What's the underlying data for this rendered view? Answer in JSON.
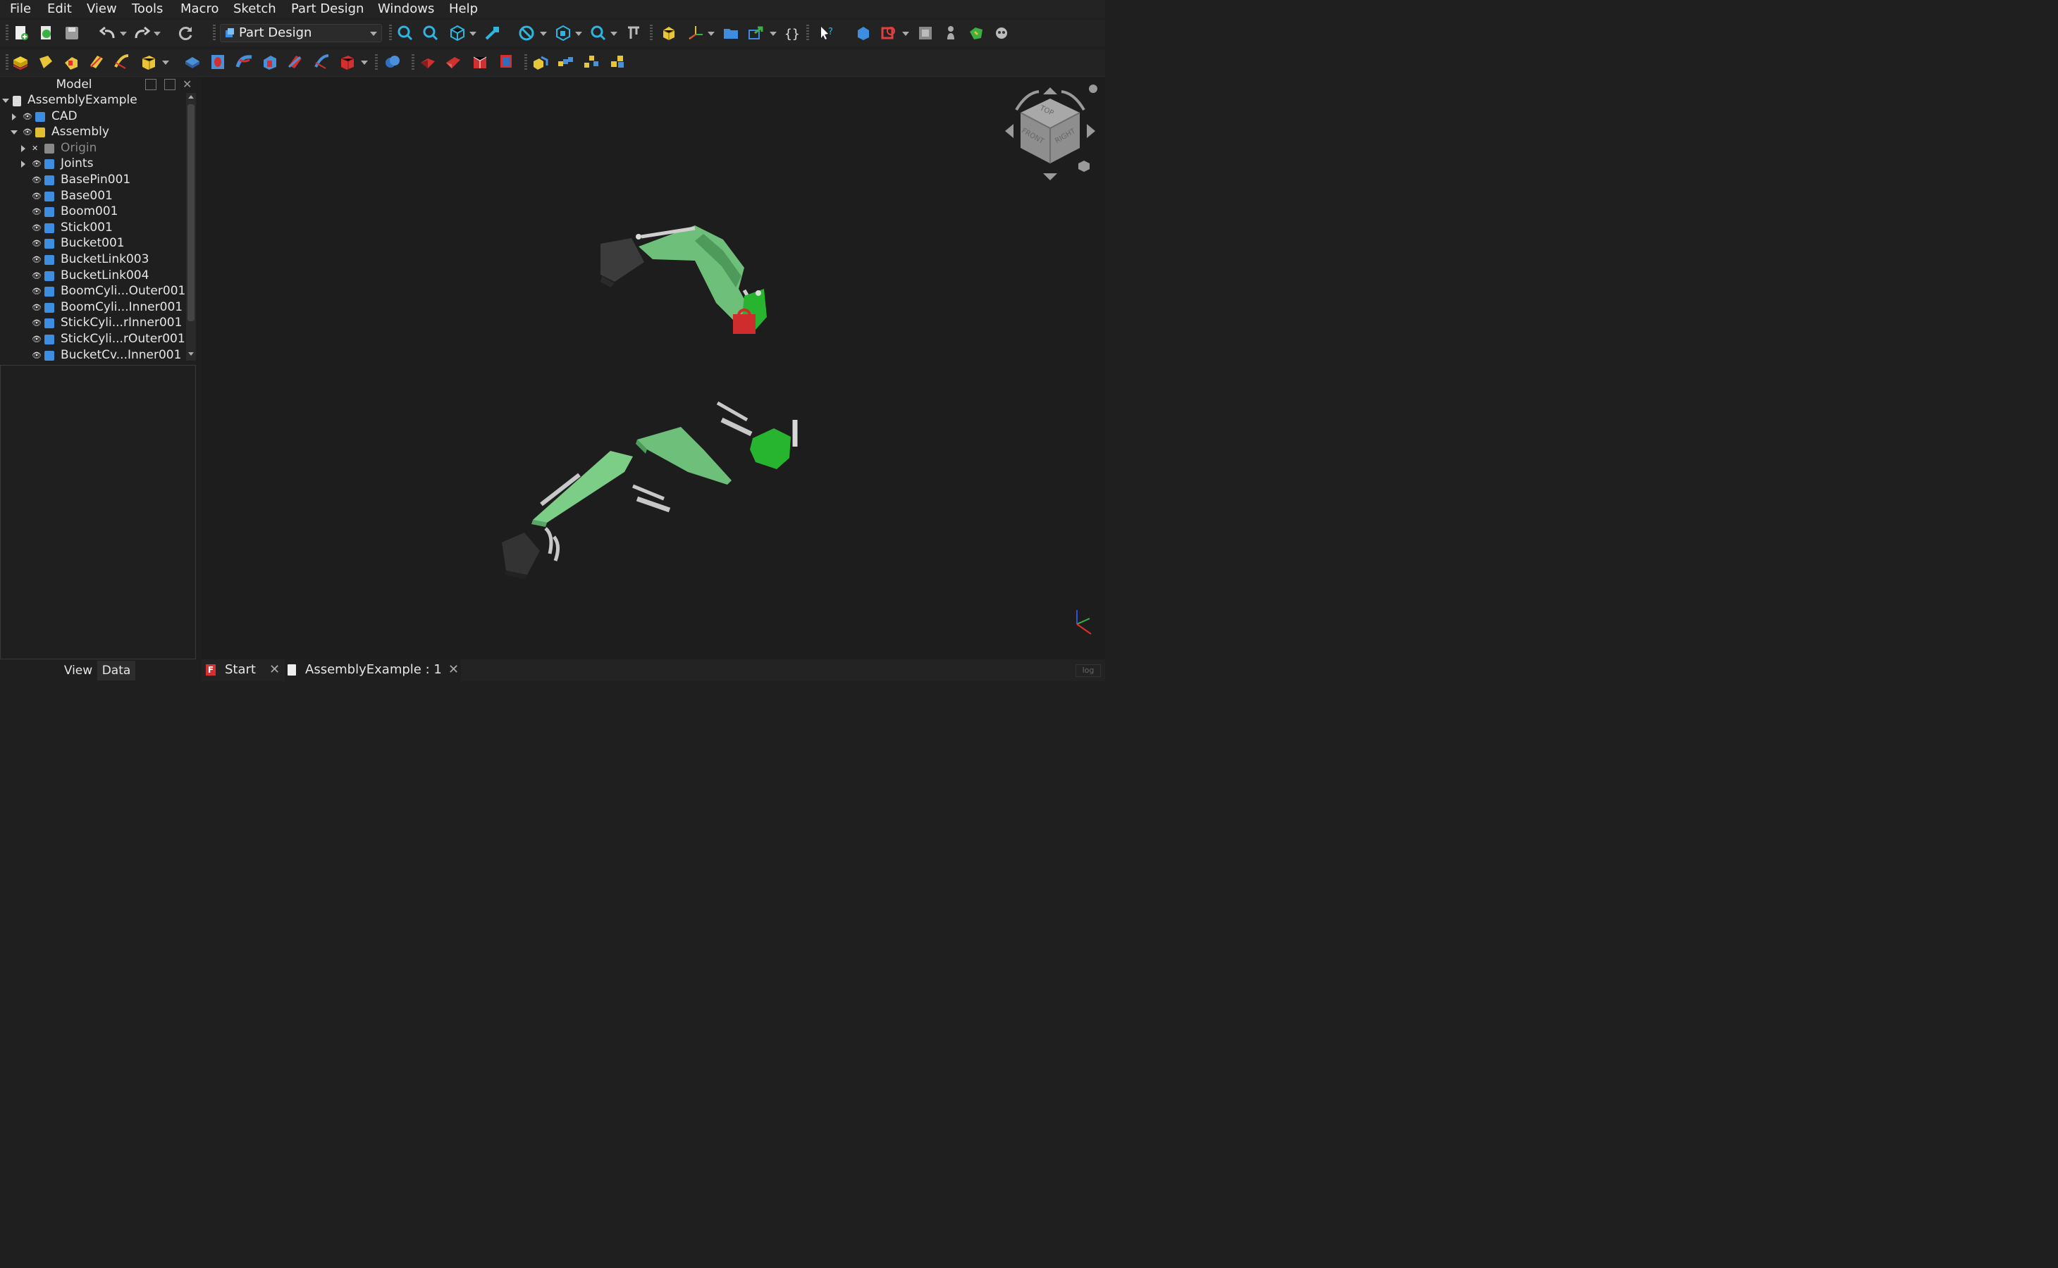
{
  "menu": [
    "File",
    "Edit",
    "View",
    "Tools",
    "Macro",
    "Sketch",
    "Part Design",
    "Windows",
    "Help"
  ],
  "workbench": {
    "label": "Part Design"
  },
  "panel": {
    "title": "Model",
    "view_tab": "View",
    "data_tab": "Data"
  },
  "tree": {
    "root": "AssemblyExample",
    "items": [
      {
        "label": "CAD",
        "level": 1,
        "expander": "collapsed",
        "icon": "folder-icon"
      },
      {
        "label": "Assembly",
        "level": 1,
        "expander": "expanded",
        "icon": "assembly-icon"
      },
      {
        "label": "Origin",
        "level": 2,
        "expander": "collapsed",
        "icon": "origin-icon",
        "dim": true
      },
      {
        "label": "Joints",
        "level": 2,
        "expander": "collapsed",
        "icon": "joints-icon"
      },
      {
        "label": "BasePin001",
        "level": 2,
        "icon": "part-icon"
      },
      {
        "label": "Base001",
        "level": 2,
        "icon": "part-icon"
      },
      {
        "label": "Boom001",
        "level": 2,
        "icon": "part-icon"
      },
      {
        "label": "Stick001",
        "level": 2,
        "icon": "part-icon"
      },
      {
        "label": "Bucket001",
        "level": 2,
        "icon": "part-icon"
      },
      {
        "label": "BucketLink003",
        "level": 2,
        "icon": "part-icon"
      },
      {
        "label": "BucketLink004",
        "level": 2,
        "icon": "part-icon"
      },
      {
        "label": "BoomCyli...Outer001",
        "level": 2,
        "icon": "part-icon"
      },
      {
        "label": "BoomCyli...Inner001",
        "level": 2,
        "icon": "part-icon"
      },
      {
        "label": "StickCyli...rInner001",
        "level": 2,
        "icon": "part-icon"
      },
      {
        "label": "StickCyli...rOuter001",
        "level": 2,
        "icon": "part-icon"
      },
      {
        "label": "BucketCv...Inner001",
        "level": 2,
        "icon": "part-icon"
      }
    ]
  },
  "navcube": {
    "top": "TOP",
    "front": "FRONT",
    "right": "RIGHT"
  },
  "doc_tabs": [
    {
      "label": "Start",
      "icon": "freecad-icon"
    },
    {
      "label": "AssemblyExample : 1",
      "icon": "document-icon"
    }
  ],
  "log_label": "log",
  "colors": {
    "accent": "#2f9fd8",
    "part_green": "#6dbf7a",
    "bright_green": "#27b52f",
    "lock_red": "#cf2d2d"
  }
}
